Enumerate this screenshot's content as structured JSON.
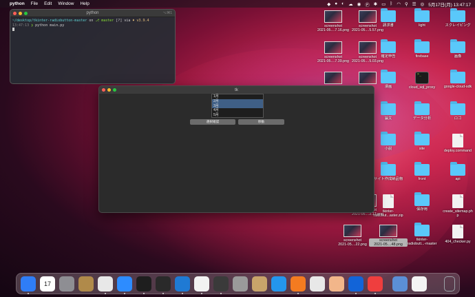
{
  "menubar": {
    "app_name": "python",
    "menus": [
      "File",
      "Edit",
      "Window",
      "Help"
    ],
    "clock": "5月17日(月) 13:47:17"
  },
  "terminal": {
    "title": "python",
    "shortcut": "⌥⌘1",
    "prompt_path": "~/desktop/tkinter-radiobutton-master",
    "prompt_on": "on",
    "branch": "master",
    "branch_status": "[?]",
    "via": "via",
    "python_version": "v3.9.4",
    "time": "13:47:13",
    "command": "python main.py"
  },
  "tk_window": {
    "title": "tk",
    "listbox_items": [
      "1月",
      "2月",
      "3月",
      "4月",
      "5月"
    ],
    "selected_indices": [
      1,
      2
    ],
    "confirm_button": "選択確認",
    "toggle_button": "移動"
  },
  "desktop": [
    {
      "label": "screenshot\n2021-05....7.16.png",
      "kind": "shot"
    },
    {
      "label": "screenshot\n2021-05....5.57.png",
      "kind": "shot"
    },
    {
      "label": "請求書",
      "kind": "folder"
    },
    {
      "label": "light",
      "kind": "folder"
    },
    {
      "label": "スクレイピング",
      "kind": "folder"
    },
    {
      "label": "screenshot\n2021-05....7.39.png",
      "kind": "shot"
    },
    {
      "label": "screenshot\n2021-05....5.03.png",
      "kind": "shot"
    },
    {
      "label": "確定申告",
      "kind": "folder"
    },
    {
      "label": "firebase",
      "kind": "folder"
    },
    {
      "label": "画像",
      "kind": "folder"
    },
    {
      "label": "",
      "kind": "shot"
    },
    {
      "label": "",
      "kind": "shot"
    },
    {
      "label": "漫画",
      "kind": "folder"
    },
    {
      "label": "cloud_sql_proxy",
      "kind": "term"
    },
    {
      "label": "google-cloud-sdk",
      "kind": "folder"
    },
    {
      "label": "論文",
      "kind": "folder"
    },
    {
      "label": "データ分析",
      "kind": "folder"
    },
    {
      "label": "ロゴ",
      "kind": "folder"
    },
    {
      "label": "小説",
      "kind": "folder"
    },
    {
      "label": "site",
      "kind": "folder"
    },
    {
      "label": "deploy.command",
      "kind": "doc"
    },
    {
      "label": "サイト作成納品物",
      "kind": "folder"
    },
    {
      "label": "front",
      "kind": "folder"
    },
    {
      "label": "api",
      "kind": "folder"
    },
    {
      "label": "tkinter-\nradiobut...aster.zip",
      "kind": "doc"
    },
    {
      "label": "保存用",
      "kind": "folder"
    },
    {
      "label": "create_sitemap.ph\np",
      "kind": "doc"
    },
    {
      "label": "screenshot\n2021-05....2.13.png",
      "kind": "shot"
    },
    {
      "label": "screenshot\n2021-05....22.png",
      "kind": "shot"
    },
    {
      "label": "screenshot\n2021-05....48.png",
      "kind": "shot"
    },
    {
      "label": "tkinter-\nradiobutt...-master",
      "kind": "folder"
    },
    {
      "label": "404_checker.py",
      "kind": "doc"
    }
  ],
  "dock": {
    "calendar_day": "17",
    "apps": [
      {
        "name": "finder-icon",
        "color": "#2f7df6"
      },
      {
        "name": "calendar-icon",
        "color": "#ffffff"
      },
      {
        "name": "system-preferences-icon",
        "color": "#8e8e93"
      },
      {
        "name": "archive-icon",
        "color": "#b08a4a"
      },
      {
        "name": "chrome-icon",
        "color": "#e8e8e8"
      },
      {
        "name": "zoom-icon",
        "color": "#2d8cff"
      },
      {
        "name": "iterm-icon",
        "color": "#1e1e1e"
      },
      {
        "name": "terminal-icon",
        "color": "#2a2a2a"
      },
      {
        "name": "vscode-icon",
        "color": "#1f7ad4"
      },
      {
        "name": "safari-icon",
        "color": "#f2f2f2"
      },
      {
        "name": "quicktime-icon",
        "color": "#3a3a3a"
      },
      {
        "name": "database-icon",
        "color": "#9a9a9a"
      },
      {
        "name": "scripteditor-icon",
        "color": "#c8a46a"
      },
      {
        "name": "docker-icon",
        "color": "#2496ed"
      },
      {
        "name": "sourcetree-icon",
        "color": "#f47b20"
      },
      {
        "name": "sequel-icon",
        "color": "#e8e8e8"
      },
      {
        "name": "preview-icon",
        "color": "#f2b68a"
      },
      {
        "name": "infinity-icon",
        "color": "#1264d8"
      },
      {
        "name": "clock-icon",
        "color": "#ef3e3e"
      },
      {
        "name": "downloads-icon",
        "color": "#5b8fd6"
      },
      {
        "name": "document-icon",
        "color": "#f3f3f3"
      },
      {
        "name": "trash-icon",
        "color": "#9ca2a8"
      }
    ]
  }
}
